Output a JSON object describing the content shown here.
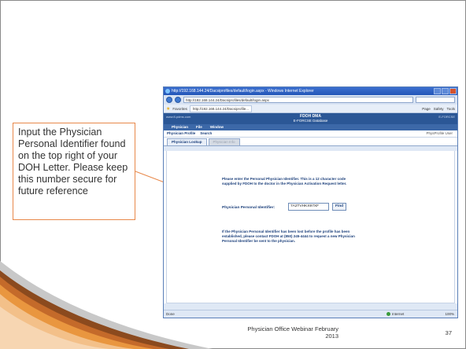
{
  "callout": {
    "text": "Input the Physician Personal Identifier found on the top right of your DOH Letter. Please keep this number secure for future reference"
  },
  "browser": {
    "title": "http://192.168.144.24/Dacsiprofiles/default/login.aspx - Windows Internet Explorer",
    "url": "http://192.168.144.24/Dacsiprofiles/default/login.aspx",
    "favorites_label": "Favorites",
    "fav_tab": "http://192.168.144.24/Dacsiprofile...",
    "tools": [
      "Page",
      "Safety",
      "Tools"
    ],
    "status_left": "Done",
    "status_zone": "Internet",
    "status_zoom": "100%"
  },
  "app": {
    "header_left": "www.fl-pdms.com",
    "header_right": "E-FORCSE",
    "title": "FDOH DMA",
    "subtitle": "E-FORCSE Database",
    "nav": [
      "Physician",
      "File",
      "Window"
    ],
    "profile_bar": [
      "Physician Profile",
      "Search"
    ],
    "profile_right": "PhysProfile User",
    "tabs": [
      {
        "label": "Physician Lookup",
        "active": true
      },
      {
        "label": "Physician Info",
        "active": false
      }
    ],
    "instruction": "Please enter the Personal Physician Identifier. This is a 12 character code supplied by FDOH to the doctor in the Physician Activation Request letter.",
    "field_label": "Physician Personal Identifier:",
    "field_value": "7A2TVHKX97XF",
    "find_button": "Find",
    "note": "If the Physician Personal Identifier has been lost before the profile has been established, please contact FDOH at (850) 245-4444 to request a new Physician Personal Identifier be sent to the physician."
  },
  "footer": {
    "line1": "Physician Office Webinar February",
    "line2": "2013",
    "page_number": "37"
  },
  "colors": {
    "callout_border": "#e8884a",
    "app_header": "#2b5796",
    "title_bar": "#2356b8"
  }
}
